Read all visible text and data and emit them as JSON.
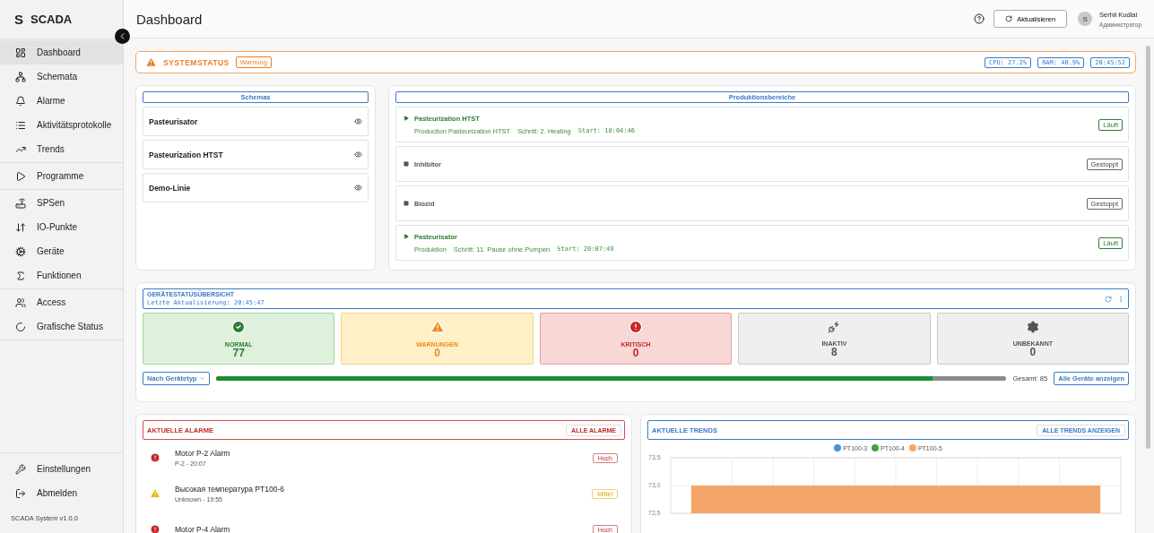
{
  "brand": {
    "letter": "S",
    "name": "SCADA"
  },
  "sidebar": {
    "groups": [
      [
        {
          "label": "Dashboard",
          "selected": true
        },
        {
          "label": "Schemata",
          "selected": false
        },
        {
          "label": "Alarme",
          "selected": false
        },
        {
          "label": "Aktivitätsprotokolle",
          "selected": false
        },
        {
          "label": "Trends",
          "selected": false
        }
      ],
      [
        {
          "label": "Programme",
          "selected": false
        }
      ],
      [
        {
          "label": "SPSen",
          "selected": false
        },
        {
          "label": "IO-Punkte",
          "selected": false
        },
        {
          "label": "Geräte",
          "selected": false
        },
        {
          "label": "Funktionen",
          "selected": false
        }
      ],
      [
        {
          "label": "Access",
          "selected": false
        },
        {
          "label": "Grafische Status",
          "selected": false
        }
      ]
    ],
    "bottom": [
      {
        "label": "Einstellungen"
      },
      {
        "label": "Abmelden"
      }
    ],
    "version": "SCADA System v1.0.0"
  },
  "header": {
    "title": "Dashboard",
    "refresh": "Aktualisieren",
    "user": {
      "initial": "S",
      "name": "Serhii Kudlai",
      "role": "Администратор"
    }
  },
  "system_status": {
    "title": "SYSTEMSTATUS",
    "badge": "Warnung",
    "metrics": [
      "CPU: 27.2%",
      "RAM: 40.9%",
      "20:45:52"
    ]
  },
  "schemas": {
    "title": "Schemas",
    "items": [
      "Pasteurisator",
      "Pasteurization HTST",
      "Demo-Linie"
    ]
  },
  "production": {
    "title": "Produktionsbereiche",
    "areas": [
      {
        "name": "Pasteurization HTST",
        "running": true,
        "status": "Läuft",
        "details": [
          "Production Pasteurization HTST",
          "Schritt: 2. Heating"
        ],
        "start": "Start: 18:04:46"
      },
      {
        "name": "Inhibitor",
        "running": false,
        "status": "Gestoppt"
      },
      {
        "name": "Biozid",
        "running": false,
        "status": "Gestoppt"
      },
      {
        "name": "Pasteurisator",
        "running": true,
        "status": "Läuft",
        "details": [
          "Produktion",
          "Schritt: 11. Pause ohne Pumpen"
        ],
        "start": "Start: 20:07:49"
      }
    ]
  },
  "device_status": {
    "title": "GERÄTESTATUSÜBERSICHT",
    "updated": "Letzte Aktualisierung: 20:45:47",
    "tiles": [
      {
        "kind": "normal",
        "label": "NORMAL",
        "count": "77"
      },
      {
        "kind": "warning",
        "label": "WARNUNGEN",
        "count": "0"
      },
      {
        "kind": "critical",
        "label": "KRITISCH",
        "count": "0"
      },
      {
        "kind": "inactive",
        "label": "INAKTIV",
        "count": "8"
      },
      {
        "kind": "unknown",
        "label": "UNBEKANNT",
        "count": "0"
      }
    ],
    "group_by": "Nach Gerätetyp",
    "level": 0.906,
    "total": "Gesamt: 85",
    "all_button": "Alle Geräte anzeigen"
  },
  "alarms": {
    "title": "AKTUELLE ALARME",
    "all_button": "ALLE ALARME",
    "items": [
      {
        "kind": "high",
        "title": "Motor P-2 Alarm",
        "meta": "P-2 - 20:07",
        "severity": "Hoch"
      },
      {
        "kind": "medium",
        "title": "Высокая температура PT100-6",
        "meta": "Unknown - 19:55",
        "severity": "Mittel"
      },
      {
        "kind": "high",
        "title": "Motor P-4 Alarm",
        "severity": "Hoch"
      }
    ]
  },
  "trends": {
    "title": "AKTUELLE TRENDS",
    "all_button": "ALLE TRENDS ANZEIGEN",
    "chart_data": {
      "type": "area",
      "grid": true,
      "categories": [
        null,
        null,
        null,
        null,
        null,
        null,
        null,
        null,
        null,
        null,
        null
      ],
      "ylim": [
        72.5,
        73.5
      ],
      "yticks": [
        {
          "value": 73.5,
          "label": "73,5"
        },
        {
          "value": 73.0,
          "label": "73,0"
        },
        {
          "value": 72.5,
          "label": "72,5"
        }
      ],
      "series": [
        {
          "name": "PT100-3",
          "color": "#4a90e2",
          "values": [
            null,
            null,
            null,
            null,
            null,
            null,
            null,
            null,
            null,
            null,
            null
          ]
        },
        {
          "name": "PT100-4",
          "color": "#43a047",
          "values": [
            null,
            null,
            null,
            null,
            null,
            null,
            null,
            null,
            null,
            null,
            null
          ]
        },
        {
          "name": "PT100-5",
          "color": "#f4a66a",
          "values": [
            73.0,
            73.0,
            73.0,
            73.0,
            73.0,
            73.0,
            73.0,
            73.0,
            73.0,
            73.0,
            73.0
          ]
        }
      ]
    }
  }
}
